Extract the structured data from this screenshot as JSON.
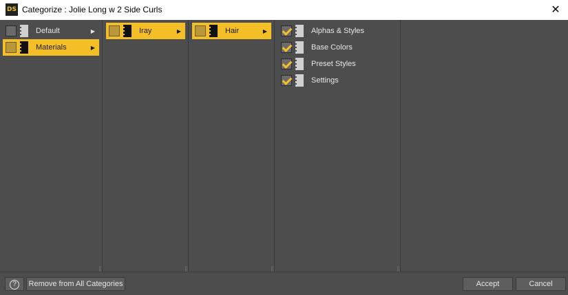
{
  "window": {
    "title": "Categorize : Jolie Long w 2 Side Curls",
    "app_icon_text": "DS",
    "close_symbol": "✕"
  },
  "columns": [
    {
      "items": [
        {
          "label": "Default",
          "selected": false,
          "has_submenu": true
        },
        {
          "label": "Materials",
          "selected": true,
          "has_submenu": true
        }
      ]
    },
    {
      "items": [
        {
          "label": "Iray",
          "selected": true,
          "has_submenu": true
        }
      ]
    },
    {
      "items": [
        {
          "label": "Hair",
          "selected": true,
          "has_submenu": true
        }
      ]
    },
    {
      "items": [
        {
          "label": "Alphas & Styles",
          "checked": true
        },
        {
          "label": "Base Colors",
          "checked": true
        },
        {
          "label": "Preset Styles",
          "checked": true
        },
        {
          "label": "Settings",
          "checked": true
        }
      ]
    }
  ],
  "footer": {
    "help_symbol": "?",
    "remove_label": "Remove from All Categories",
    "accept_label": "Accept",
    "cancel_label": "Cancel"
  },
  "icons": {
    "submenu_arrow": "▶",
    "folder": "folder-icon",
    "checkbox": "checkbox-icon"
  },
  "colors": {
    "accent": "#f4bf26",
    "panel_bg": "#4d4d4d",
    "text": "#e6e6e6"
  }
}
